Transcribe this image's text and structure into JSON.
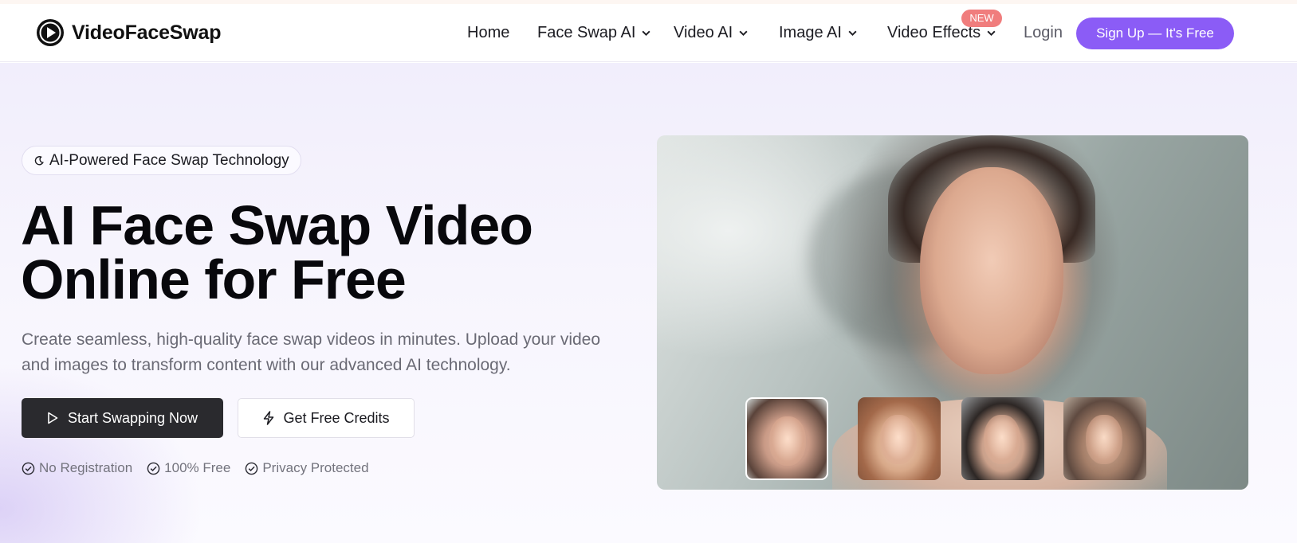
{
  "brand": {
    "name": "VideoFaceSwap",
    "logo_icon": "play-face-logo-icon"
  },
  "nav": {
    "items": [
      {
        "label": "Home",
        "dropdown": false
      },
      {
        "label": "Face Swap AI",
        "dropdown": true
      },
      {
        "label": "Video AI",
        "dropdown": true
      },
      {
        "label": "Image AI",
        "dropdown": true
      },
      {
        "label": "Video Effects",
        "dropdown": true,
        "badge": "NEW"
      }
    ],
    "login_label": "Login",
    "signup_label": "Sign Up — It's Free"
  },
  "hero": {
    "pill_label": "AI-Powered Face Swap Technology",
    "title_line1": "AI Face Swap Video",
    "title_line2": "Online for Free",
    "subtitle": "Create seamless, high-quality face swap videos in minutes. Upload your video and images to transform content with our advanced AI technology.",
    "primary_cta": "Start Swapping Now",
    "secondary_cta": "Get Free Credits",
    "features": [
      "No Registration",
      "100% Free",
      "Privacy Protected"
    ]
  },
  "showcase": {
    "thumbnails": [
      {
        "name": "thumbnail-woman-dark-hair",
        "active": true
      },
      {
        "name": "thumbnail-woman-auburn-hair",
        "active": false
      },
      {
        "name": "thumbnail-man-dark-hair",
        "active": false
      },
      {
        "name": "thumbnail-woman-vintage",
        "active": false
      }
    ]
  },
  "colors": {
    "accent": "#8b5cf6",
    "badge": "#f07d7d",
    "primary_button": "#2a2a2e"
  }
}
